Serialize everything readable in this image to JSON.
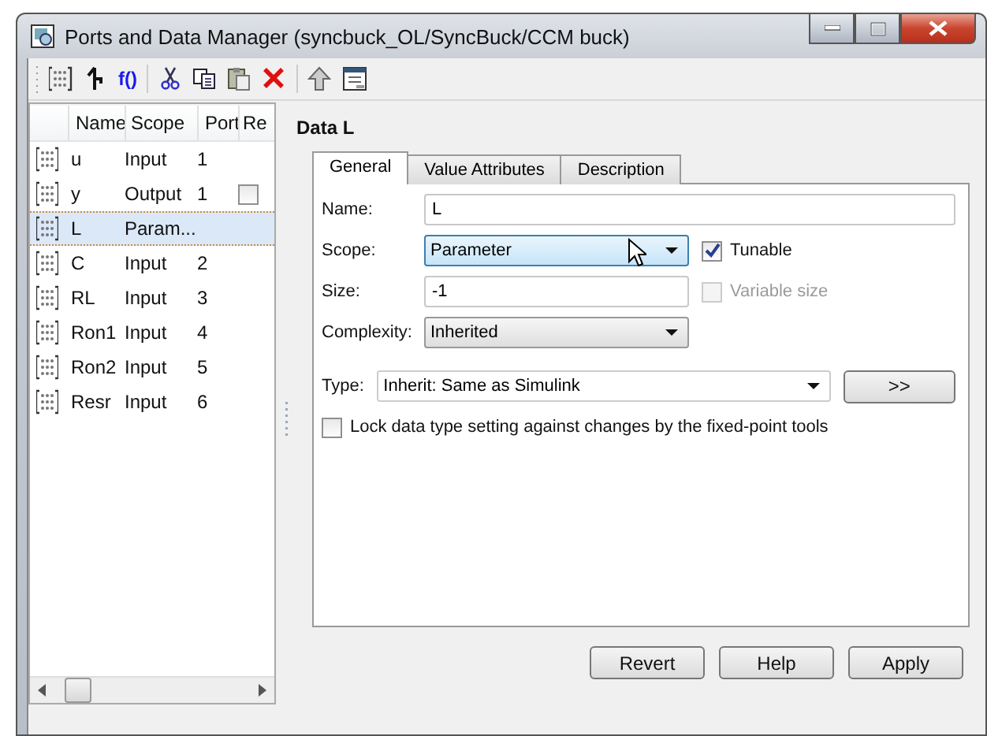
{
  "window": {
    "title": "Ports and Data Manager (syncbuck_OL/SyncBuck/CCM buck)"
  },
  "toolbar": [
    {
      "kind": "data"
    },
    {
      "kind": "signal"
    },
    {
      "kind": "function",
      "label": "f()"
    },
    {
      "kind": "separator"
    },
    {
      "kind": "cut"
    },
    {
      "kind": "copy"
    },
    {
      "kind": "paste"
    },
    {
      "kind": "delete"
    },
    {
      "kind": "separator"
    },
    {
      "kind": "up"
    },
    {
      "kind": "dialog"
    }
  ],
  "table": {
    "columns": [
      "Name",
      "Scope",
      "Port",
      "Re"
    ],
    "rows": [
      {
        "name": "u",
        "scope": "Input",
        "port": "1",
        "selected": false
      },
      {
        "name": "y",
        "scope": "Output",
        "port": "1",
        "selected": false,
        "column_4_checked": false
      },
      {
        "name": "L",
        "scope": "Param...",
        "selected": true
      },
      {
        "name": "C",
        "scope": "Input",
        "port": "2",
        "selected": false
      },
      {
        "name": "RL",
        "scope": "Input",
        "port": "3",
        "selected": false
      },
      {
        "name": "Ron1",
        "scope": "Input",
        "port": "4",
        "selected": false
      },
      {
        "name": "Ron2",
        "scope": "Input",
        "port": "5",
        "selected": false
      },
      {
        "name": "Resr",
        "scope": "Input",
        "port": "6",
        "selected": false
      }
    ]
  },
  "details": {
    "heading": "Data L",
    "tabs": [
      {
        "label": "General",
        "selected": true
      },
      {
        "label": "Value Attributes",
        "selected": false
      },
      {
        "label": "Description",
        "selected": false
      }
    ],
    "name": {
      "label": "Name:",
      "value": "L"
    },
    "scope": {
      "label": "Scope:",
      "value": "Parameter",
      "hovered": true
    },
    "tunable": {
      "label": "Tunable",
      "checked": true,
      "disabled": false
    },
    "size": {
      "label": "Size:",
      "value": "-1"
    },
    "variable_size": {
      "label": "Variable size",
      "checked": false,
      "disabled": true
    },
    "complexity": {
      "label": "Complexity:",
      "value": "Inherited"
    },
    "type": {
      "label": "Type:",
      "value": "Inherit: Same as Simulink",
      "button": ">>"
    },
    "lock": {
      "label": "Lock data type setting against changes by the fixed-point tools",
      "checked": false,
      "disabled": false
    }
  },
  "buttons": [
    "Revert",
    "Help",
    "Apply"
  ]
}
